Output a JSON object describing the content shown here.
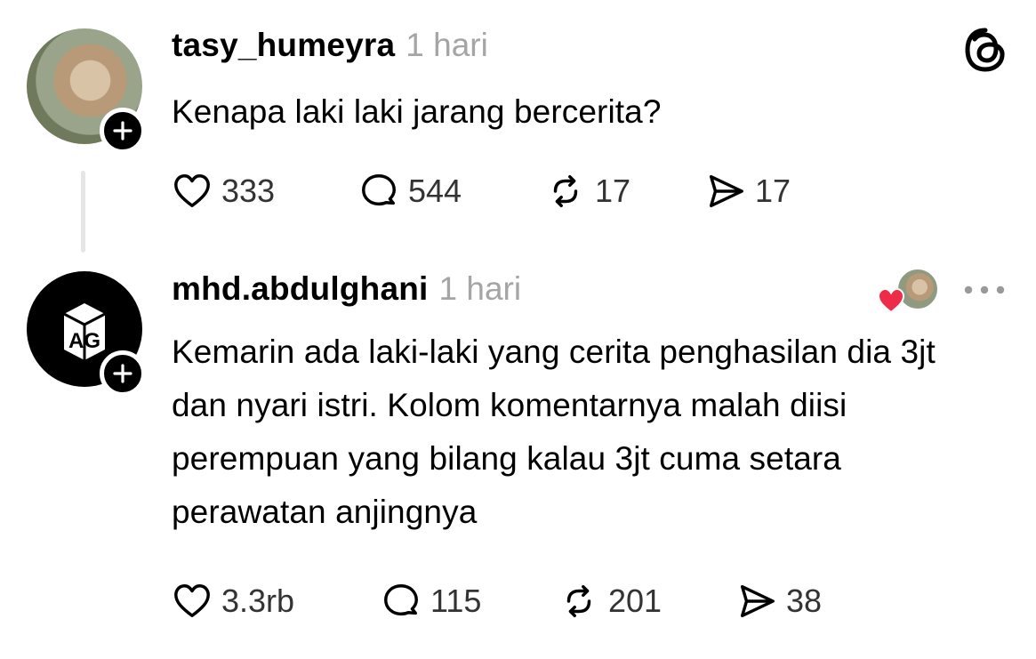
{
  "post": {
    "username": "tasy_humeyra",
    "time": "1 hari",
    "text": "Kenapa laki laki jarang bercerita?",
    "likes": "333",
    "replies": "544",
    "reposts": "17",
    "shares": "17"
  },
  "reply": {
    "username": "mhd.abdulghani",
    "time": "1 hari",
    "text": "Kemarin ada laki-laki yang cerita penghasilan dia 3jt dan nyari istri. Kolom komentarnya malah diisi perempuan yang bilang kalau 3jt cuma setara perawatan anjingnya",
    "likes": "3.3rb",
    "replies": "115",
    "reposts": "201",
    "shares": "38",
    "avatar_logo": "AG"
  },
  "icons": {
    "app_logo": "threads-logo-icon",
    "like": "heart-icon",
    "reply": "comment-icon",
    "repost": "repost-icon",
    "share": "send-icon",
    "follow": "plus-icon",
    "more": "more-dots-icon"
  },
  "colors": {
    "heart": "#ef2b4a",
    "muted": "#a5a5a5",
    "thread_line": "#e6e6e6"
  }
}
